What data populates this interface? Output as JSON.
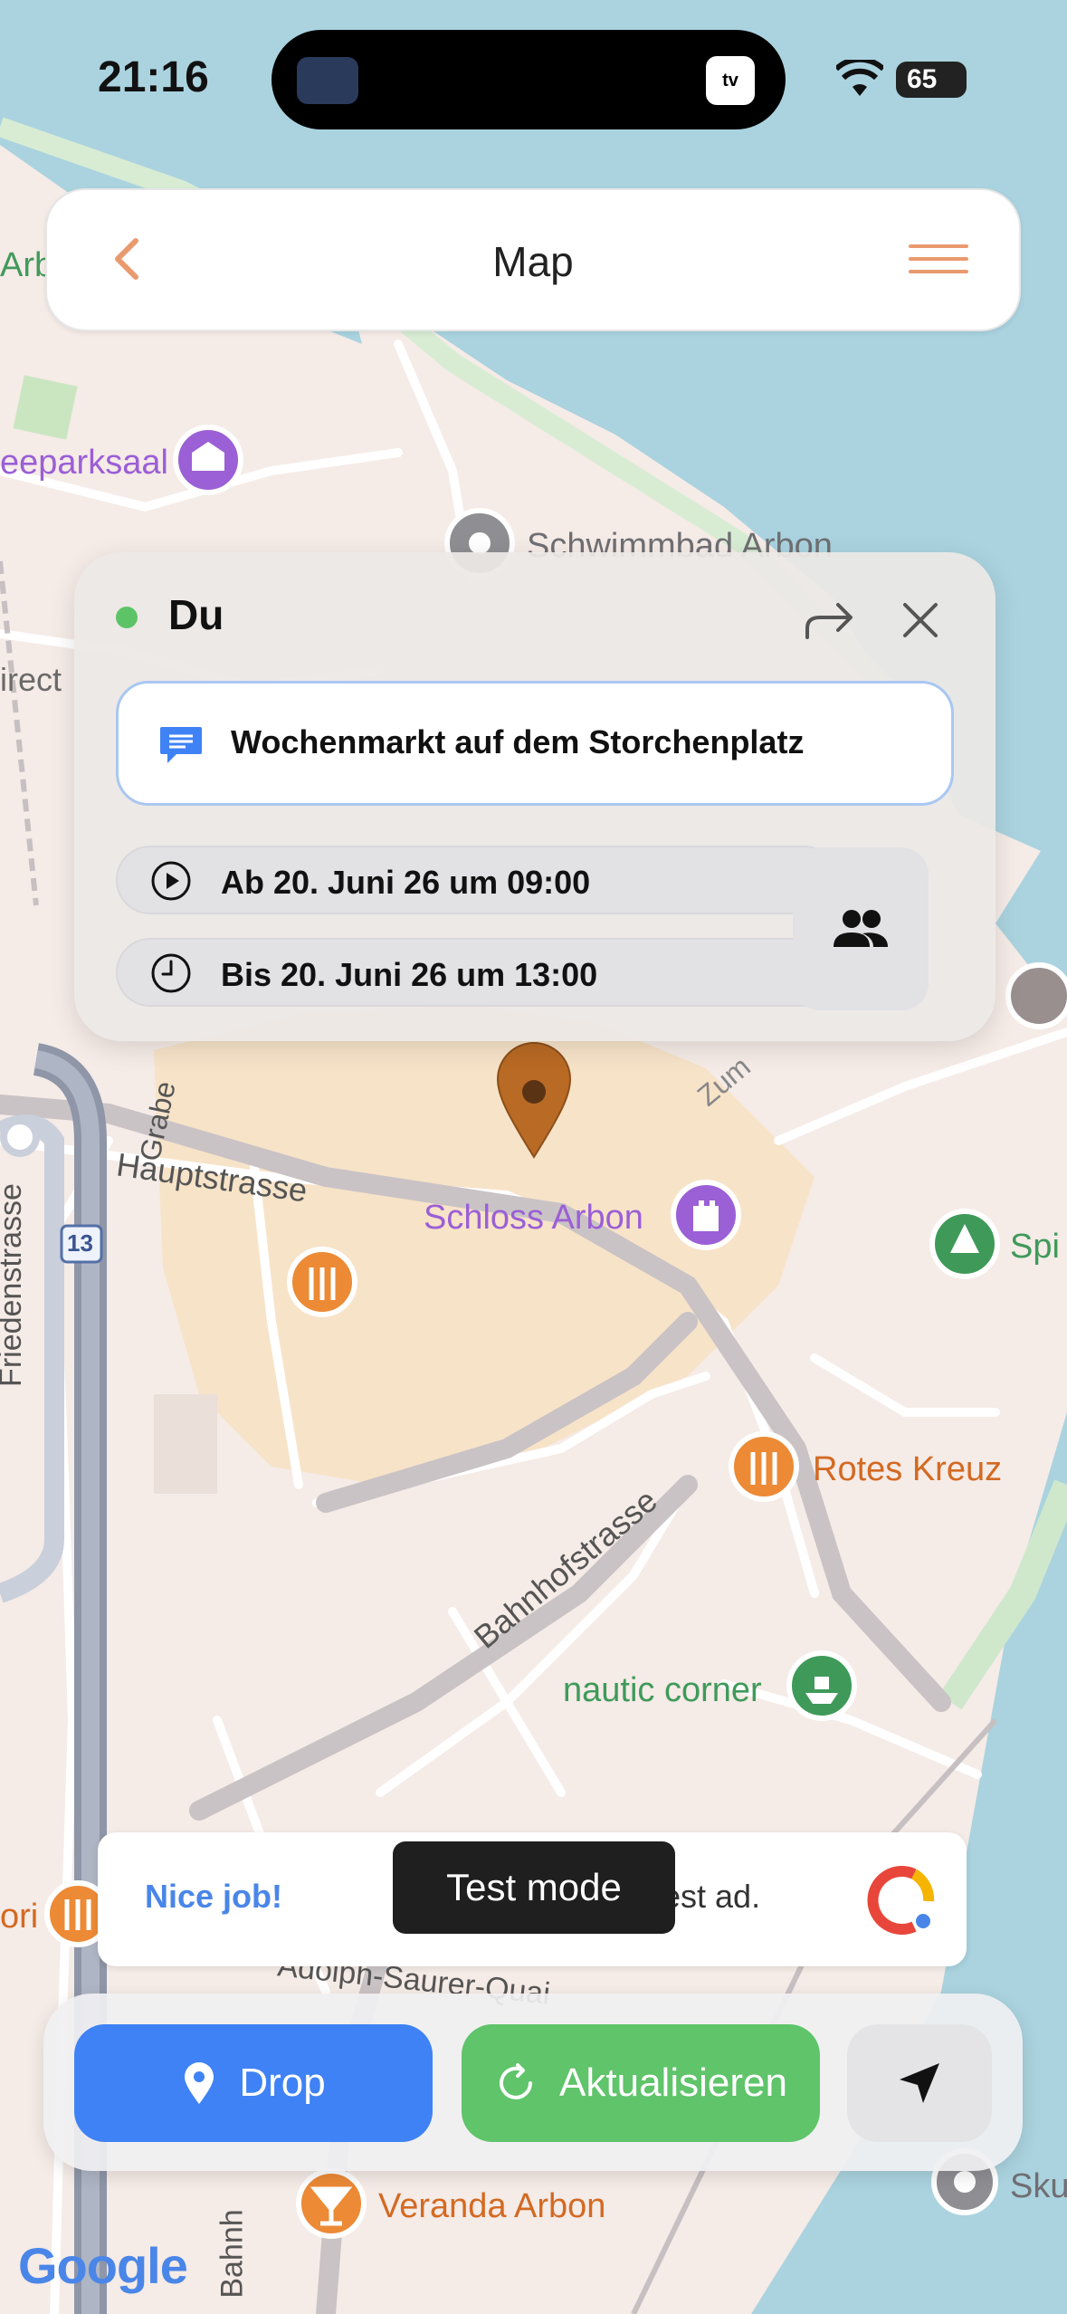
{
  "status_bar": {
    "time": "21:16",
    "battery": "65",
    "island_badge": "tv"
  },
  "header": {
    "title": "Map",
    "back_icon": "chevron-left-icon",
    "menu_icon": "hamburger-menu-icon",
    "accent_color": "#e99a6e"
  },
  "map": {
    "labels": {
      "arb_partial": "Arb",
      "seeparksaal": "eeparksaal",
      "schwimmbad": "Schwimmbad Arbon",
      "irect_partial": "irect",
      "grabe": "Grabe",
      "zum": "Zum",
      "hauptstrasse": "Hauptstrasse",
      "friedenstrasse": "Friedenstrasse",
      "route_13": "13",
      "schloss_arbon": "Schloss Arbon",
      "spi_partial": "Spi",
      "rotes_kreuz": "Rotes Kreuz",
      "bahnhofstrasse": "Bahnhofstrasse",
      "nautic_corner": "nautic corner",
      "ori_partial": "ori",
      "adolph": "Adolph-Saurer-Quai",
      "veranda_arbon": "Veranda Arbon",
      "bahnh_partial": "Bahnh",
      "sku_partial": "Sku",
      "google": "Google"
    },
    "colors": {
      "water": "#aad3df",
      "land": "#f5ebe7",
      "old_town": "#f7e3c8",
      "road": "#ffffff",
      "poi_purple": "#9b5fd6",
      "poi_orange": "#ec8a36",
      "poi_green": "#3f9a5a",
      "pin": "#b96a24"
    }
  },
  "event_card": {
    "owner": "Du",
    "status_color": "#5cc466",
    "title": "Wochenmarkt auf dem Storchenplatz",
    "start": "Ab 20. Juni 26 um 09:00",
    "end": "Bis 20. Juni 26 um 13:00"
  },
  "ad": {
    "nice": "Nice job!",
    "test_suffix": "est ad.",
    "toast": "Test mode"
  },
  "controls": {
    "drop": "Drop",
    "refresh": "Aktualisieren",
    "drop_color": "#3f82f5",
    "refresh_color": "#5fc46a"
  }
}
